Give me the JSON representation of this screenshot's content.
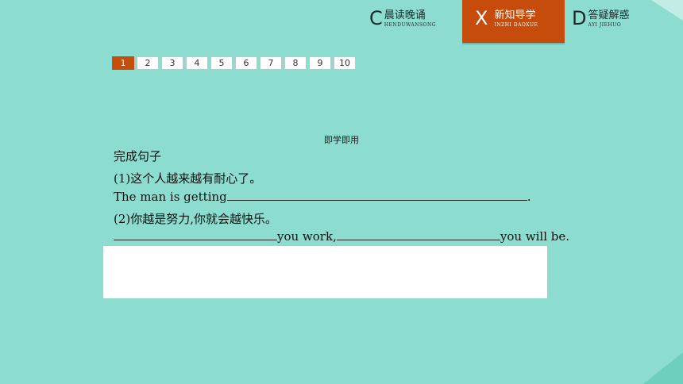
{
  "nav": {
    "tabs": [
      {
        "letter": "C",
        "label": "晨读晚诵",
        "pinyin": "HENDUWANSONG"
      },
      {
        "letter": "X",
        "label": "新知导学",
        "pinyin": "INZHI DAOXUE"
      },
      {
        "letter": "D",
        "label": "答疑解惑",
        "pinyin": "AYI JIEHUO"
      }
    ]
  },
  "pager": {
    "pages": [
      "1",
      "2",
      "3",
      "4",
      "5",
      "6",
      "7",
      "8",
      "9",
      "10"
    ],
    "current": "1"
  },
  "content": {
    "section_title": "即学即用",
    "heading": "完成句子",
    "q1_cn": "(1)这个人越来越有耐心了。",
    "q1_en_prefix": "The man is getting",
    "q1_en_suffix": ".",
    "q2_cn": "(2)你越是努力,你就会越快乐。",
    "q2_en_mid": "you work,",
    "q2_en_end": "you will be."
  },
  "colors": {
    "background": "#8cdccf",
    "accent": "#c54c0b"
  }
}
